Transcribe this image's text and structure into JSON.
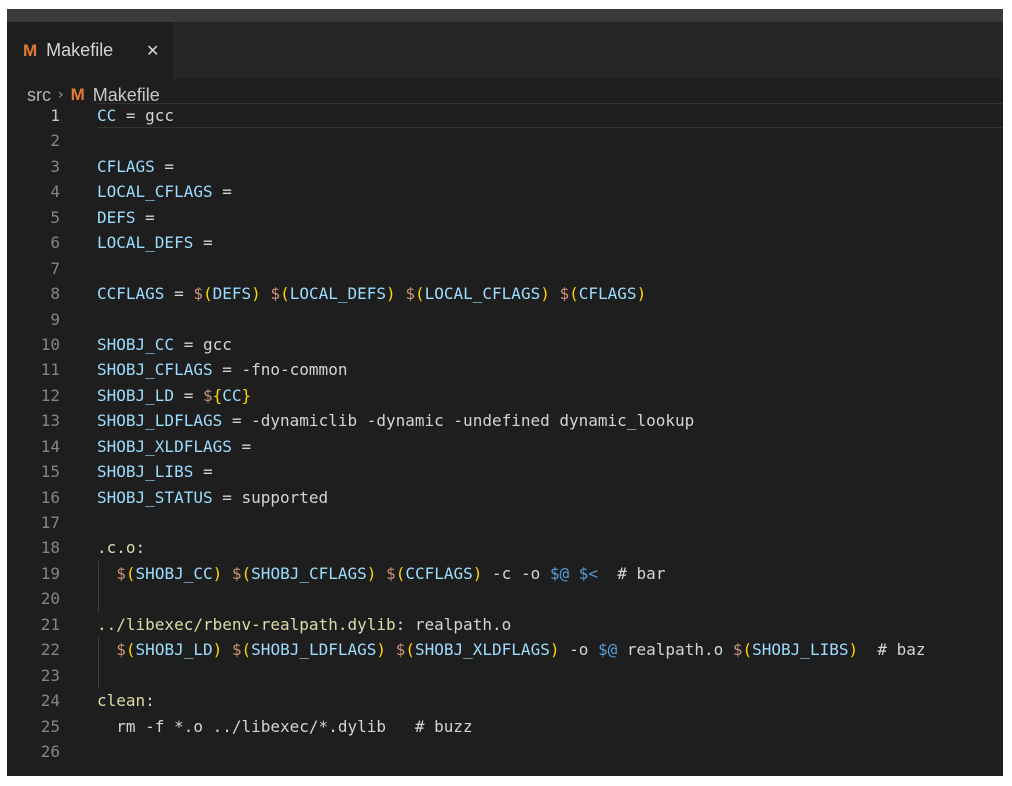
{
  "tab": {
    "icon": "M",
    "label": "Makefile",
    "close_glyph": "✕"
  },
  "breadcrumb": {
    "folder": "src",
    "separator": "›",
    "icon": "M",
    "file": "Makefile"
  },
  "editor": {
    "current_line": 1,
    "lines": [
      {
        "n": "1",
        "indent": false,
        "tokens": [
          [
            "v",
            "CC"
          ],
          [
            "p",
            " = gcc"
          ]
        ]
      },
      {
        "n": "2",
        "indent": false,
        "tokens": []
      },
      {
        "n": "3",
        "indent": false,
        "tokens": [
          [
            "v",
            "CFLAGS"
          ],
          [
            "p",
            " ="
          ]
        ]
      },
      {
        "n": "4",
        "indent": false,
        "tokens": [
          [
            "v",
            "LOCAL_CFLAGS"
          ],
          [
            "p",
            " ="
          ]
        ]
      },
      {
        "n": "5",
        "indent": false,
        "tokens": [
          [
            "v",
            "DEFS"
          ],
          [
            "p",
            " ="
          ]
        ]
      },
      {
        "n": "6",
        "indent": false,
        "tokens": [
          [
            "v",
            "LOCAL_DEFS"
          ],
          [
            "p",
            " ="
          ]
        ]
      },
      {
        "n": "7",
        "indent": false,
        "tokens": []
      },
      {
        "n": "8",
        "indent": false,
        "tokens": [
          [
            "v",
            "CCFLAGS"
          ],
          [
            "p",
            " = "
          ],
          [
            "d",
            "$"
          ],
          [
            "b",
            "("
          ],
          [
            "v",
            "DEFS"
          ],
          [
            "b",
            ")"
          ],
          [
            "p",
            " "
          ],
          [
            "d",
            "$"
          ],
          [
            "b",
            "("
          ],
          [
            "v",
            "LOCAL_DEFS"
          ],
          [
            "b",
            ")"
          ],
          [
            "p",
            " "
          ],
          [
            "d",
            "$"
          ],
          [
            "b",
            "("
          ],
          [
            "v",
            "LOCAL_CFLAGS"
          ],
          [
            "b",
            ")"
          ],
          [
            "p",
            " "
          ],
          [
            "d",
            "$"
          ],
          [
            "b",
            "("
          ],
          [
            "v",
            "CFLAGS"
          ],
          [
            "b",
            ")"
          ]
        ]
      },
      {
        "n": "9",
        "indent": false,
        "tokens": []
      },
      {
        "n": "10",
        "indent": false,
        "tokens": [
          [
            "v",
            "SHOBJ_CC"
          ],
          [
            "p",
            " = gcc"
          ]
        ]
      },
      {
        "n": "11",
        "indent": false,
        "tokens": [
          [
            "v",
            "SHOBJ_CFLAGS"
          ],
          [
            "p",
            " = -fno-common"
          ]
        ]
      },
      {
        "n": "12",
        "indent": false,
        "tokens": [
          [
            "v",
            "SHOBJ_LD"
          ],
          [
            "p",
            " = "
          ],
          [
            "d",
            "$"
          ],
          [
            "b",
            "{"
          ],
          [
            "v",
            "CC"
          ],
          [
            "b",
            "}"
          ]
        ]
      },
      {
        "n": "13",
        "indent": false,
        "tokens": [
          [
            "v",
            "SHOBJ_LDFLAGS"
          ],
          [
            "p",
            " = -dynamiclib -dynamic -undefined dynamic_lookup"
          ]
        ]
      },
      {
        "n": "14",
        "indent": false,
        "tokens": [
          [
            "v",
            "SHOBJ_XLDFLAGS"
          ],
          [
            "p",
            " ="
          ]
        ]
      },
      {
        "n": "15",
        "indent": false,
        "tokens": [
          [
            "v",
            "SHOBJ_LIBS"
          ],
          [
            "p",
            " ="
          ]
        ]
      },
      {
        "n": "16",
        "indent": false,
        "tokens": [
          [
            "v",
            "SHOBJ_STATUS"
          ],
          [
            "p",
            " = supported"
          ]
        ]
      },
      {
        "n": "17",
        "indent": false,
        "tokens": []
      },
      {
        "n": "18",
        "indent": false,
        "tokens": [
          [
            "t",
            ".c.o"
          ],
          [
            "p",
            ":"
          ]
        ]
      },
      {
        "n": "19",
        "indent": true,
        "tokens": [
          [
            "p",
            "  "
          ],
          [
            "d",
            "$"
          ],
          [
            "b",
            "("
          ],
          [
            "v",
            "SHOBJ_CC"
          ],
          [
            "b",
            ")"
          ],
          [
            "p",
            " "
          ],
          [
            "d",
            "$"
          ],
          [
            "b",
            "("
          ],
          [
            "v",
            "SHOBJ_CFLAGS"
          ],
          [
            "b",
            ")"
          ],
          [
            "p",
            " "
          ],
          [
            "d",
            "$"
          ],
          [
            "b",
            "("
          ],
          [
            "v",
            "CCFLAGS"
          ],
          [
            "b",
            ")"
          ],
          [
            "p",
            " -c -o "
          ],
          [
            "a",
            "$@"
          ],
          [
            "p",
            " "
          ],
          [
            "a",
            "$<"
          ],
          [
            "p",
            "  # bar"
          ]
        ]
      },
      {
        "n": "20",
        "indent": true,
        "tokens": []
      },
      {
        "n": "21",
        "indent": false,
        "tokens": [
          [
            "t",
            "../libexec/rbenv-realpath.dylib"
          ],
          [
            "p",
            ": realpath.o"
          ]
        ]
      },
      {
        "n": "22",
        "indent": true,
        "tokens": [
          [
            "p",
            "  "
          ],
          [
            "d",
            "$"
          ],
          [
            "b",
            "("
          ],
          [
            "v",
            "SHOBJ_LD"
          ],
          [
            "b",
            ")"
          ],
          [
            "p",
            " "
          ],
          [
            "d",
            "$"
          ],
          [
            "b",
            "("
          ],
          [
            "v",
            "SHOBJ_LDFLAGS"
          ],
          [
            "b",
            ")"
          ],
          [
            "p",
            " "
          ],
          [
            "d",
            "$"
          ],
          [
            "b",
            "("
          ],
          [
            "v",
            "SHOBJ_XLDFLAGS"
          ],
          [
            "b",
            ")"
          ],
          [
            "p",
            " -o "
          ],
          [
            "a",
            "$@"
          ],
          [
            "p",
            " realpath.o "
          ],
          [
            "d",
            "$"
          ],
          [
            "b",
            "("
          ],
          [
            "v",
            "SHOBJ_LIBS"
          ],
          [
            "b",
            ")"
          ],
          [
            "p",
            "  # baz"
          ]
        ]
      },
      {
        "n": "23",
        "indent": true,
        "tokens": []
      },
      {
        "n": "24",
        "indent": false,
        "tokens": [
          [
            "t",
            "clean"
          ],
          [
            "p",
            ":"
          ]
        ]
      },
      {
        "n": "25",
        "indent": false,
        "tokens": [
          [
            "p",
            "  rm -f *.o ../libexec/*.dylib   # buzz"
          ]
        ]
      },
      {
        "n": "26",
        "indent": false,
        "tokens": []
      }
    ]
  }
}
